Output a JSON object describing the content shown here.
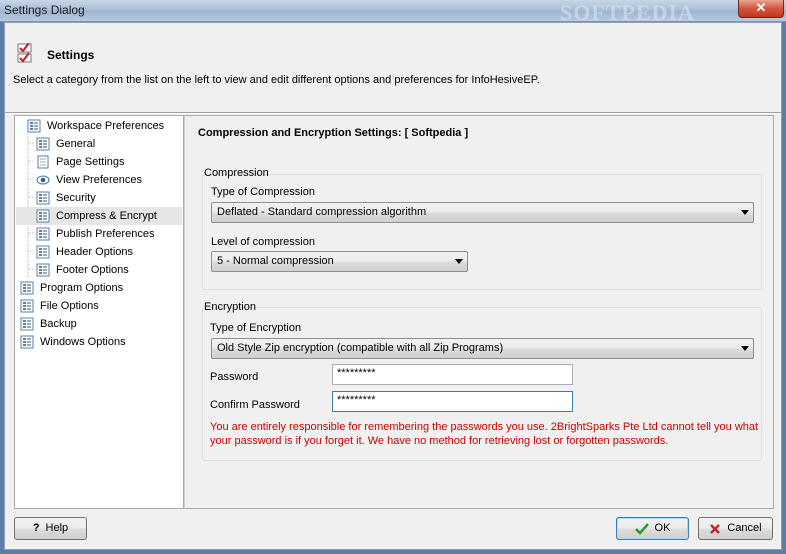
{
  "window": {
    "title": "Settings Dialog",
    "watermark": "SOFTPEDIA",
    "close_label": "✕"
  },
  "header": {
    "title": "Settings",
    "description": "Select a category from the list on the left to view and edit different options and preferences for InfoHesiveEP."
  },
  "tree": {
    "items": [
      {
        "label": "Workspace Preferences",
        "icon": "page-grid-icon",
        "level": 0
      },
      {
        "label": "General",
        "icon": "page-grid-icon",
        "level": 1
      },
      {
        "label": "Page Settings",
        "icon": "page-icon",
        "level": 1
      },
      {
        "label": "View Preferences",
        "icon": "eye-icon",
        "level": 1
      },
      {
        "label": "Security",
        "icon": "page-grid-icon",
        "level": 1
      },
      {
        "label": "Compress & Encrypt",
        "icon": "page-grid-icon",
        "level": 1,
        "selected": true
      },
      {
        "label": "Publish Preferences",
        "icon": "page-grid-icon",
        "level": 1
      },
      {
        "label": "Header Options",
        "icon": "page-grid-icon",
        "level": 1
      },
      {
        "label": "Footer Options",
        "icon": "page-grid-icon",
        "level": 1
      },
      {
        "label": "Program Options",
        "icon": "page-grid-icon",
        "level": 0
      },
      {
        "label": "File Options",
        "icon": "page-grid-icon",
        "level": 0
      },
      {
        "label": "Backup",
        "icon": "page-grid-icon",
        "level": 0
      },
      {
        "label": "Windows Options",
        "icon": "page-grid-icon",
        "level": 0
      }
    ]
  },
  "panel": {
    "title": "Compression and Encryption Settings:  [ Softpedia ]",
    "compression": {
      "group_label": "Compression",
      "type_label": "Type of Compression",
      "type_value": "Deflated - Standard compression algorithm",
      "level_label": "Level of compression",
      "level_value": "5 - Normal compression"
    },
    "encryption": {
      "group_label": "Encryption",
      "type_label": "Type of Encryption",
      "type_value": "Old Style Zip encryption (compatible with all Zip Programs)",
      "password_label": "Password",
      "password_value": "*********",
      "confirm_label": "Confirm Password",
      "confirm_value": "*********",
      "warning": "You are entirely responsible for remembering the passwords you use. 2BrightSparks Pte Ltd cannot tell you what your password is if you forget it. We have no method for retrieving lost or forgotten passwords."
    }
  },
  "footer": {
    "help_label": "Help",
    "ok_label": "OK",
    "cancel_label": "Cancel"
  },
  "colors": {
    "warning": "#cc0000",
    "ok_check": "#2e9a2e",
    "cancel_x": "#c0282a"
  }
}
